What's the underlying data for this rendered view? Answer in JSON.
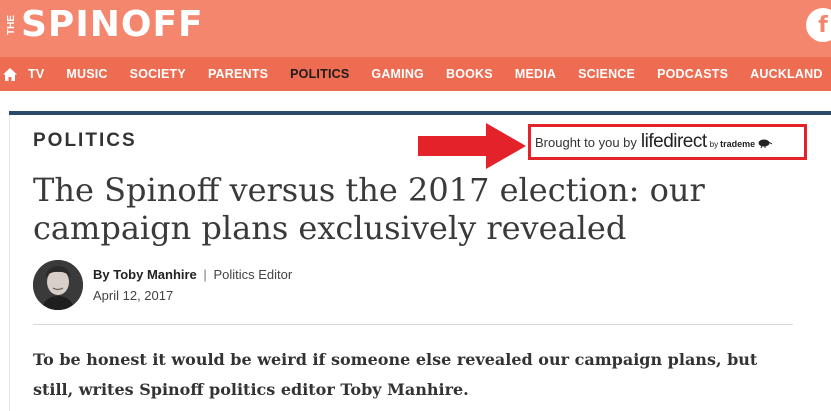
{
  "site": {
    "logo_prefix_top": "THE",
    "logo_word": "SPINOFF",
    "facebook_glyph": "f",
    "brand_color": "#f4866d",
    "nav_color": "#ee6c51",
    "home_icon": "home-icon"
  },
  "nav": {
    "items": [
      "TV",
      "MUSIC",
      "SOCIETY",
      "PARENTS",
      "POLITICS",
      "GAMING",
      "BOOKS",
      "MEDIA",
      "SCIENCE",
      "PODCASTS",
      "AUCKLAND"
    ],
    "active": "POLITICS"
  },
  "article": {
    "section": "POLITICS",
    "sponsor": {
      "prefix": "Brought to you by",
      "brand": "lifedirect",
      "by": "by",
      "parent": "trademe",
      "highlight_color": "#e4222a"
    },
    "headline": "The Spinoff versus the 2017 election: our campaign plans exclusively revealed",
    "byline": {
      "by_prefix": "By",
      "author": "Toby Manhire",
      "separator": "|",
      "role": "Politics Editor"
    },
    "date": "April 12, 2017",
    "standfirst": "To be honest it would be weird if someone else revealed our campaign plans, but still, writes Spinoff politics editor Toby Manhire."
  }
}
